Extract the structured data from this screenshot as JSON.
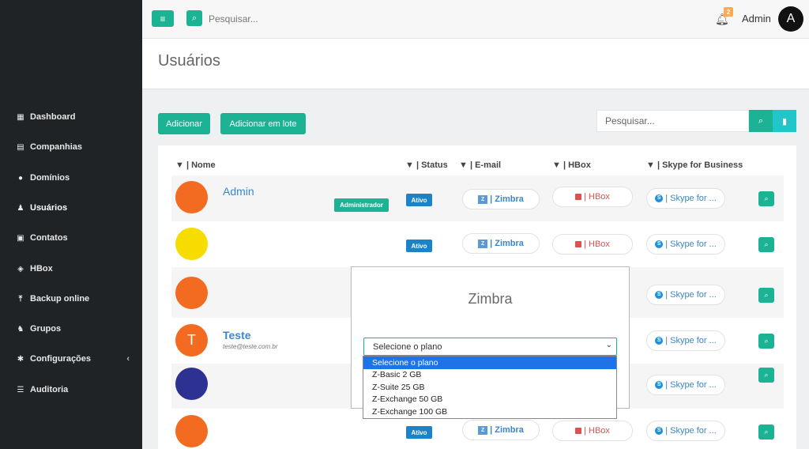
{
  "topbar": {
    "menu_icon": "hamburger-icon",
    "search_placeholder": "Pesquisar...",
    "notification_count": "2",
    "user_name": "Admin",
    "user_initial": "A"
  },
  "sidebar": {
    "items": [
      {
        "label": "Dashboard",
        "icon": "grid-icon",
        "glyph": "▦"
      },
      {
        "label": "Companhias",
        "icon": "building-icon",
        "glyph": "▤"
      },
      {
        "label": "Domínios",
        "icon": "globe-icon",
        "glyph": "●"
      },
      {
        "label": "Usuários",
        "icon": "user-icon",
        "glyph": "♟"
      },
      {
        "label": "Contatos",
        "icon": "address-card-icon",
        "glyph": "▣"
      },
      {
        "label": "HBox",
        "icon": "cube-icon",
        "glyph": "◈"
      },
      {
        "label": "Backup online",
        "icon": "upload-icon",
        "glyph": "⤒"
      },
      {
        "label": "Grupos",
        "icon": "users-icon",
        "glyph": "♞"
      },
      {
        "label": "Configurações",
        "icon": "cog-icon",
        "glyph": "✱"
      },
      {
        "label": "Auditoria",
        "icon": "list-icon",
        "glyph": "☰"
      }
    ],
    "caret": "‹"
  },
  "page": {
    "title": "Usuários",
    "add_label": "Adicionar",
    "add_batch_label": "Adicionar em lote",
    "search_placeholder": "Pesquisar..."
  },
  "table": {
    "headers": {
      "name": "| Nome",
      "status": "| Status",
      "email": "| E-mail",
      "hbox": "| HBox",
      "skype": "| Skype for Business"
    },
    "rows": [
      {
        "name": "Admin",
        "email": "",
        "role": "Administrador",
        "status": "Ativo",
        "avatar_color": "#f26b21",
        "initial": ""
      },
      {
        "name": "",
        "email": "",
        "role": "",
        "status": "Ativo",
        "avatar_color": "#f7dc00",
        "initial": ""
      },
      {
        "name": "",
        "email": "",
        "role": "",
        "status": "",
        "avatar_color": "#f26b21",
        "initial": ""
      },
      {
        "name": "Teste",
        "email": "teste@teste.com.br",
        "role": "",
        "status": "",
        "avatar_color": "#f26b21",
        "initial": "T"
      },
      {
        "name": "",
        "email": "",
        "role": "",
        "status": "",
        "avatar_color": "#2d3191",
        "initial": ""
      },
      {
        "name": "",
        "email": "",
        "role": "",
        "status": "Ativo",
        "avatar_color": "#f26b21",
        "initial": ""
      }
    ],
    "zimbra_label": "| Zimbra",
    "hbox_label": "| HBox",
    "skype_label": "| Skype for ..."
  },
  "modal": {
    "title": "Zimbra",
    "select_value": "Selecione o plano",
    "options": [
      "Selecione o plano",
      "Z-Basic 2 GB",
      "Z-Suite 25 GB",
      "Z-Exchange 50 GB",
      "Z-Exchange 100 GB"
    ],
    "selected_index": 0
  },
  "colors": {
    "accent": "#1bb394",
    "info": "#1c84c6",
    "danger": "#d9534f",
    "sidebar_bg": "#1f2326"
  }
}
